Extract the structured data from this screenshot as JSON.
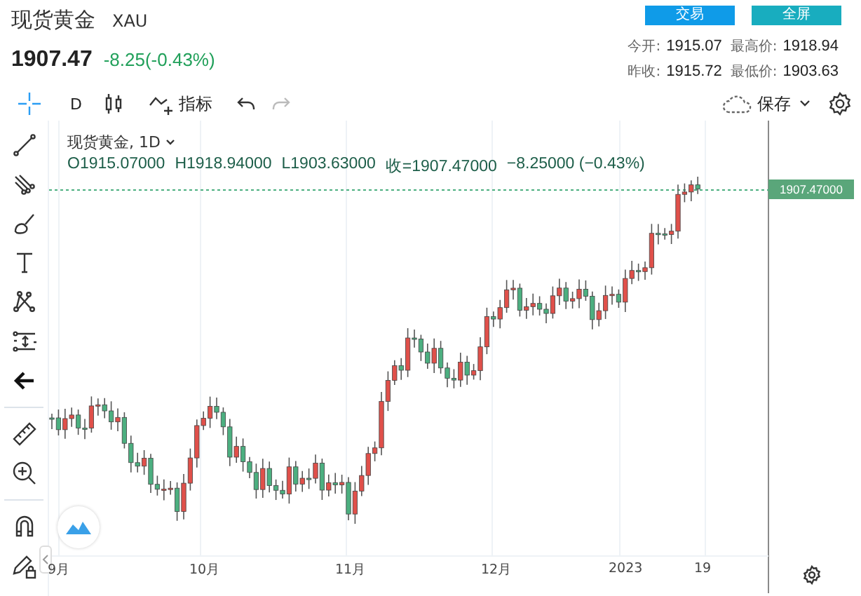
{
  "header": {
    "title": "现货黄金",
    "symbol": "XAU",
    "price": "1907.47",
    "change": "-8.25(-0.43%)",
    "buttons": [
      {
        "label": "交易",
        "kind": "trade"
      },
      {
        "label": "全屏",
        "kind": "fullscreen"
      }
    ],
    "stats": [
      {
        "label": "今开:",
        "value": "1915.07"
      },
      {
        "label": "最高价:",
        "value": "1918.94"
      },
      {
        "label": "昨收:",
        "value": "1915.72"
      },
      {
        "label": "最低价:",
        "value": "1903.63"
      }
    ]
  },
  "toolbar": {
    "interval": "D",
    "indicators": "指标",
    "save": "保存"
  },
  "legend": {
    "title": "现货黄金, 1D",
    "values": [
      "O1915.07000",
      "H1918.94000",
      "L1903.63000",
      "收=1907.47000",
      "−8.25000 (−0.43%)"
    ]
  },
  "price_label": "1907.47000",
  "x_axis": [
    "9月",
    "10月",
    "11月",
    "12月",
    "2023",
    "19"
  ]
}
